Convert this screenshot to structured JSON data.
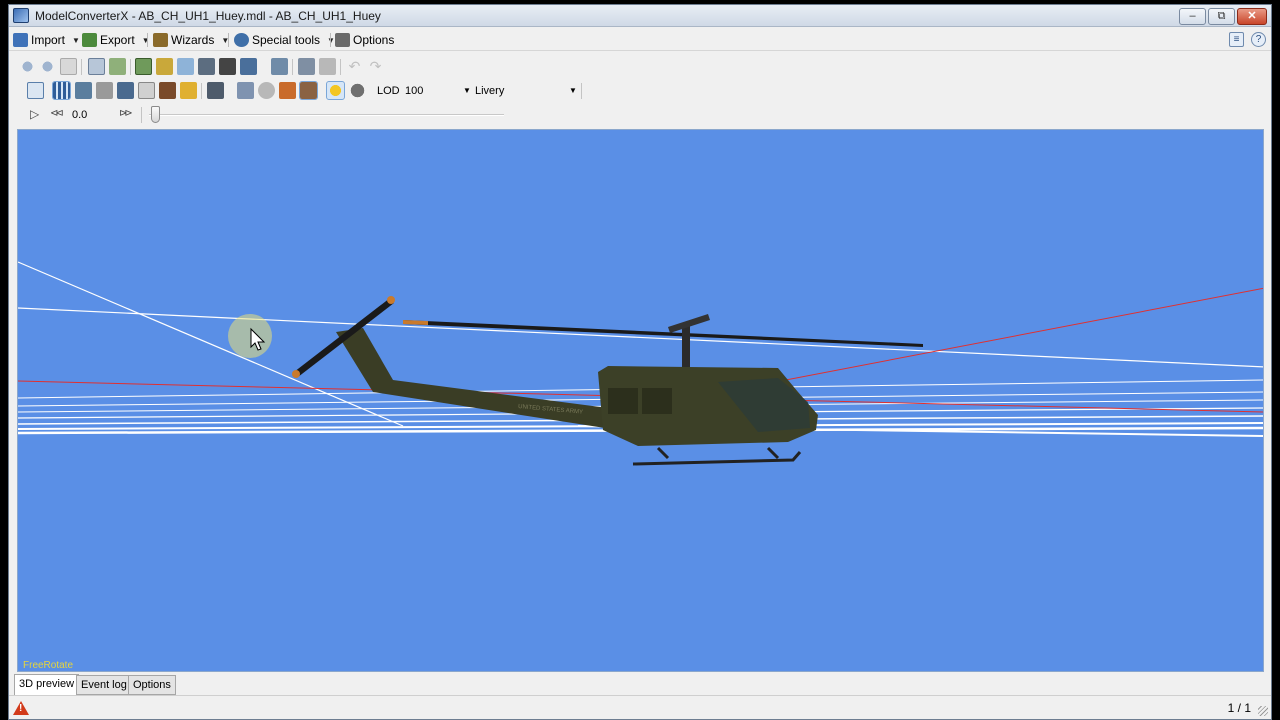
{
  "window": {
    "title": "ModelConverterX - AB_CH_UH1_Huey.mdl - AB_CH_UH1_Huey",
    "min_glyph": "–",
    "max_glyph": "⧉",
    "close_glyph": "✕"
  },
  "menu": {
    "items": [
      {
        "label": "Import",
        "icon": "import-icon",
        "color": "#3f72b8",
        "has_dropdown": true
      },
      {
        "label": "Export",
        "icon": "export-icon",
        "color": "#4c8a3c",
        "has_dropdown": true
      },
      {
        "label": "Wizards",
        "icon": "wand-icon",
        "color": "#8a6a2a",
        "has_dropdown": true
      },
      {
        "label": "Special tools",
        "icon": "gear-icon",
        "color": "#3f6fa8",
        "has_dropdown": true
      },
      {
        "label": "Options",
        "icon": "tools-icon",
        "color": "#6a6a6a",
        "has_dropdown": false
      }
    ],
    "right_icons": [
      {
        "icon": "document-icon",
        "glyph": "≡"
      },
      {
        "icon": "help-icon",
        "glyph": "?"
      }
    ]
  },
  "toolbar2": {
    "lod_label": "LOD",
    "lod_value": "100",
    "livery_label": "Livery"
  },
  "toolbar3": {
    "play_glyph": "▷",
    "rewind_glyph": "⊲⊲",
    "time_value": "0.0",
    "forward_glyph": "⊳⊳"
  },
  "viewport": {
    "mode_label": "FreeRotate",
    "background": "#5a8fe6",
    "fuselage_text": "UNITED STATES ARMY"
  },
  "tabs": [
    {
      "label": "3D preview",
      "active": true
    },
    {
      "label": "Event log",
      "active": false
    },
    {
      "label": "Options",
      "active": false
    }
  ],
  "status": {
    "page_count": "1 / 1"
  }
}
